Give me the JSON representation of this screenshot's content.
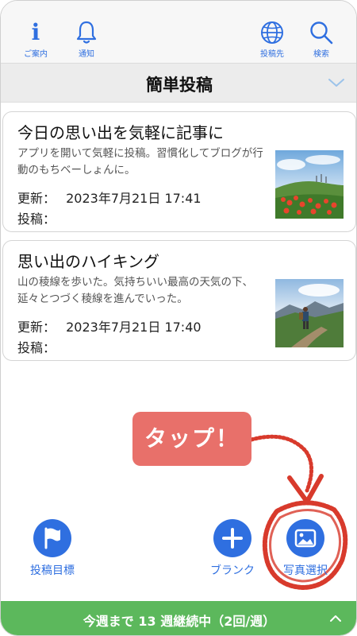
{
  "toolbar": {
    "info_label": "ご案内",
    "notify_label": "通知",
    "destination_label": "投稿先",
    "search_label": "検索",
    "info_glyph": "i"
  },
  "header": {
    "title": "簡単投稿"
  },
  "posts": [
    {
      "title": "今日の思い出を気軽に記事に",
      "body": "アプリを開いて気軽に投稿。習慣化してブログが行動のもちベーしょんに。",
      "updated_key": "更新：",
      "updated_value": "2023年7月21日 17:41",
      "posted_key": "投稿：",
      "posted_value": ""
    },
    {
      "title": "思い出のハイキング",
      "body": "山の稜線を歩いた。気持ちいい最高の天気の下、延々とつづく稜線を進んでいった。",
      "updated_key": "更新：",
      "updated_value": "2023年7月21日 17:40",
      "posted_key": "投稿：",
      "posted_value": ""
    }
  ],
  "callout": {
    "text": "タップ！"
  },
  "actions": {
    "goal_label": "投稿目標",
    "blank_label": "ブランク",
    "photo_label": "写真選択"
  },
  "streak": {
    "text": "今週まで 13 週継続中（2回/週）"
  },
  "colors": {
    "accent": "#2f6fe0",
    "streak_bar": "#5cb85c",
    "callout": "#e8706a",
    "annotation": "#d83a2c"
  },
  "icons": {
    "info": "info-icon",
    "bell": "bell-icon",
    "globe": "globe-icon",
    "search": "search-icon",
    "chevron": "chevron-down-icon",
    "flag": "flag-icon",
    "plus": "plus-icon",
    "photo": "photo-icon",
    "up": "chevron-up-icon"
  }
}
